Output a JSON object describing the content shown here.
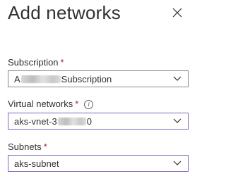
{
  "panel": {
    "title": "Add networks",
    "close_icon": "close-icon"
  },
  "fields": {
    "subscription": {
      "label": "Subscription",
      "required_mark": "*",
      "value_prefix": "A",
      "value_suffix": "Subscription"
    },
    "virtual_networks": {
      "label": "Virtual networks",
      "required_mark": "*",
      "info_icon": "info-icon",
      "info_glyph": "i",
      "value_prefix": "aks-vnet-3",
      "value_suffix": "0"
    },
    "subnets": {
      "label": "Subnets",
      "required_mark": "*",
      "value": "aks-subnet"
    }
  },
  "colors": {
    "text": "#323130",
    "required": "#a4262c",
    "border": "#8a8886",
    "active_border": "#8764b8"
  }
}
